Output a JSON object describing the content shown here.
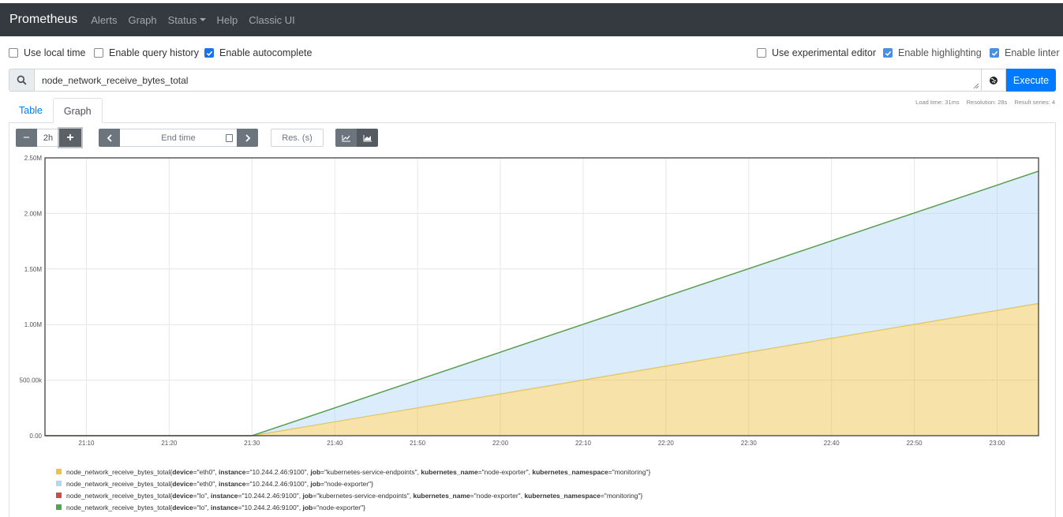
{
  "navbar": {
    "brand": "Prometheus",
    "items": [
      "Alerts",
      "Graph",
      "Status",
      "Help",
      "Classic UI"
    ]
  },
  "options_left": [
    {
      "label": "Use local time",
      "checked": false
    },
    {
      "label": "Enable query history",
      "checked": false
    },
    {
      "label": "Enable autocomplete",
      "checked": true
    }
  ],
  "options_right": [
    {
      "label": "Use experimental editor",
      "checked": false
    },
    {
      "label": "Enable highlighting",
      "checked": true
    },
    {
      "label": "Enable linter",
      "checked": true
    }
  ],
  "query": {
    "value": "node_network_receive_bytes_total",
    "execute_label": "Execute",
    "search_icon": "search-icon",
    "metrics_icon": "globe-icon"
  },
  "stats": {
    "load_time": "Load time: 31ms",
    "resolution": "Resolution: 28s",
    "result_series": "Result series: 4"
  },
  "tabs": [
    "Table",
    "Graph"
  ],
  "active_tab": "Graph",
  "controls": {
    "minus": "−",
    "range": "2h",
    "plus": "+",
    "end_time_placeholder": "End time",
    "resolution_placeholder": "Res. (s)",
    "stacked_mode": "stacked"
  },
  "chart_data": {
    "type": "area",
    "stacked": true,
    "x": [
      "21:05",
      "21:30",
      "23:05"
    ],
    "xticks": [
      "21:10",
      "21:20",
      "21:30",
      "21:40",
      "21:50",
      "22:00",
      "22:10",
      "22:20",
      "22:30",
      "22:40",
      "22:50",
      "23:00"
    ],
    "yticks": [
      "0.00",
      "500.00k",
      "1.00M",
      "1.50M",
      "2.00M",
      "2.50M"
    ],
    "ylim": [
      0,
      2500000
    ],
    "xlim": [
      "21:05",
      "23:05"
    ],
    "grid": true,
    "series": [
      {
        "color": "#edc240",
        "values": [
          0,
          0,
          1190000
        ]
      },
      {
        "color": "#afd8f8",
        "values": [
          0,
          0,
          1190000
        ]
      },
      {
        "color": "#cb4b4b",
        "values": [
          0,
          0,
          0
        ]
      },
      {
        "color": "#4da74d",
        "values": [
          0,
          0,
          0
        ]
      }
    ]
  },
  "legend": [
    {
      "color": "#edc240",
      "metric": "node_network_receive_bytes_total",
      "labels": [
        {
          "k": "device",
          "v": "\"eth0\""
        },
        {
          "k": "instance",
          "v": "\"10.244.2.46:9100\""
        },
        {
          "k": "job",
          "v": "\"kubernetes-service-endpoints\""
        },
        {
          "k": "kubernetes_name",
          "v": "\"node-exporter\""
        },
        {
          "k": "kubernetes_namespace",
          "v": "\"monitoring\""
        }
      ]
    },
    {
      "color": "#afd8f8",
      "metric": "node_network_receive_bytes_total",
      "labels": [
        {
          "k": "device",
          "v": "\"eth0\""
        },
        {
          "k": "instance",
          "v": "\"10.244.2.46:9100\""
        },
        {
          "k": "job",
          "v": "\"node-exporter\""
        }
      ]
    },
    {
      "color": "#cb4b4b",
      "metric": "node_network_receive_bytes_total",
      "labels": [
        {
          "k": "device",
          "v": "\"lo\""
        },
        {
          "k": "instance",
          "v": "\"10.244.2.46:9100\""
        },
        {
          "k": "job",
          "v": "\"kubernetes-service-endpoints\""
        },
        {
          "k": "kubernetes_name",
          "v": "\"node-exporter\""
        },
        {
          "k": "kubernetes_namespace",
          "v": "\"monitoring\""
        }
      ]
    },
    {
      "color": "#4da74d",
      "metric": "node_network_receive_bytes_total",
      "labels": [
        {
          "k": "device",
          "v": "\"lo\""
        },
        {
          "k": "instance",
          "v": "\"10.244.2.46:9100\""
        },
        {
          "k": "job",
          "v": "\"node-exporter\""
        }
      ]
    }
  ]
}
